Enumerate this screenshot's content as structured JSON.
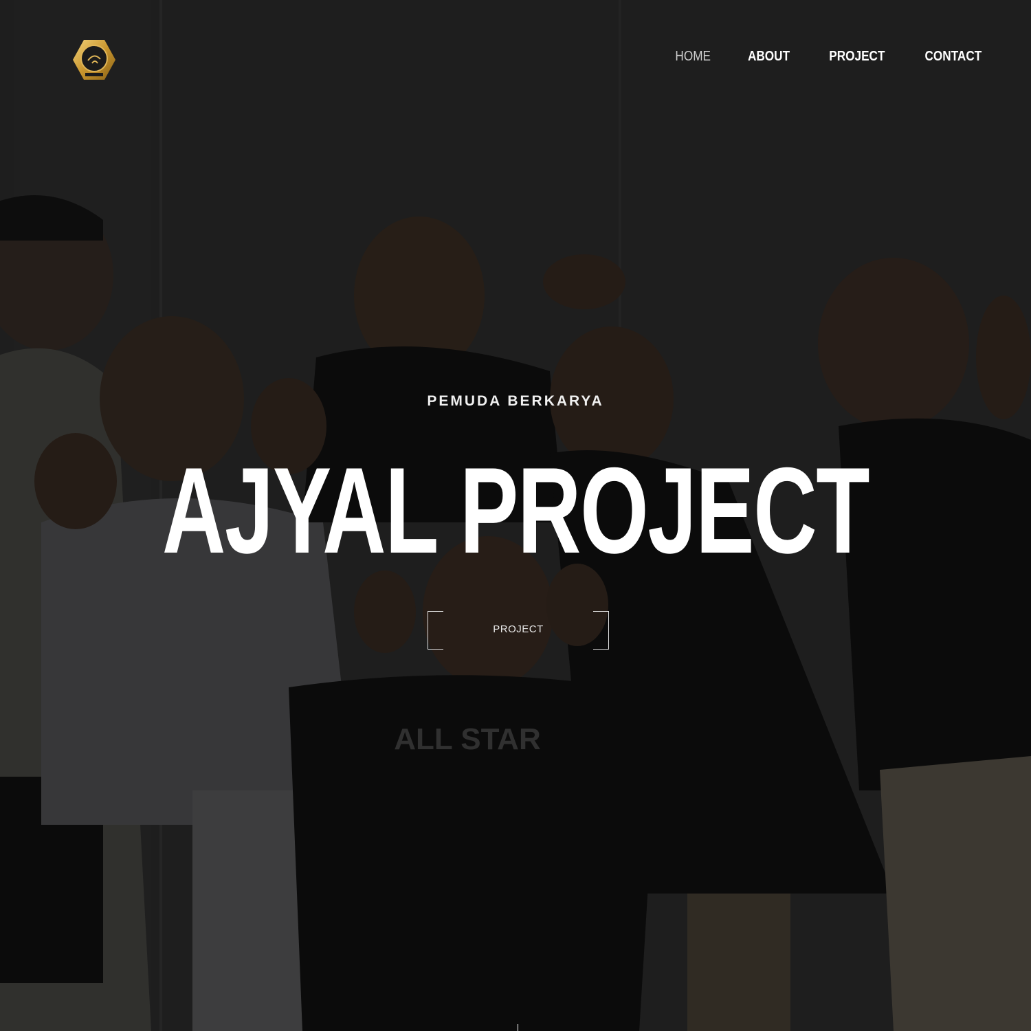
{
  "brand": {
    "logo_icon": "ajyal-project-hexagon-logo-icon",
    "logo_colors": [
      "#c9a03a",
      "#1b1b1b"
    ]
  },
  "nav": {
    "items": [
      {
        "label": "HOME",
        "active": true
      },
      {
        "label": "ABOUT",
        "active": false
      },
      {
        "label": "PROJECT",
        "active": false
      },
      {
        "label": "CONTACT",
        "active": false
      }
    ]
  },
  "hero": {
    "subtitle": "PEMUDA BERKARYA",
    "title": "AJYAL PROJECT",
    "cta_label": "PROJECT"
  },
  "colors": {
    "text": "#ffffff",
    "nav_active": "#cfcfcf",
    "overlay": "#000000"
  }
}
